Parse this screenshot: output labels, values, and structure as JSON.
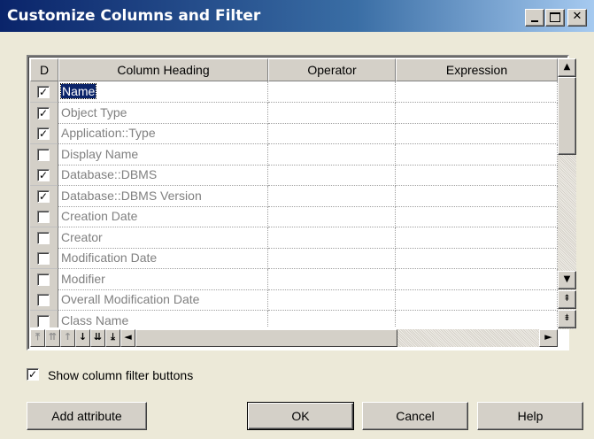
{
  "window": {
    "title": "Customize Columns and Filter",
    "min_label": "_",
    "close_label": "✕"
  },
  "grid": {
    "headers": {
      "d": "D",
      "column_heading": "Column Heading",
      "operator": "Operator",
      "expression": "Expression"
    },
    "rows": [
      {
        "checked": true,
        "name": "Name",
        "selected": true
      },
      {
        "checked": true,
        "name": "Object Type"
      },
      {
        "checked": true,
        "name": "Application::Type"
      },
      {
        "checked": false,
        "name": "Display Name"
      },
      {
        "checked": true,
        "name": "Database::DBMS"
      },
      {
        "checked": true,
        "name": "Database::DBMS Version"
      },
      {
        "checked": false,
        "name": "Creation Date"
      },
      {
        "checked": false,
        "name": "Creator"
      },
      {
        "checked": false,
        "name": "Modification Date"
      },
      {
        "checked": false,
        "name": "Modifier"
      },
      {
        "checked": false,
        "name": "Overall Modification Date"
      },
      {
        "checked": false,
        "name": "Class Name"
      }
    ],
    "scroll": {
      "up": "▲",
      "down": "▼",
      "left": "◄",
      "right": "►",
      "page_up": "⇞",
      "page_down": "⇟"
    },
    "nav_buttons": [
      "⤒",
      "⇈",
      "↑",
      "↓",
      "⇊",
      "⤓"
    ]
  },
  "show_filter": {
    "checked": true,
    "label": "Show column filter buttons"
  },
  "buttons": {
    "add_attribute": "Add attribute",
    "ok": "OK",
    "cancel": "Cancel",
    "help": "Help"
  },
  "colors": {
    "title_start": "#0a246a",
    "title_end": "#a6caf0",
    "dialog_bg": "#ece9d8",
    "disabled_text": "#808080"
  }
}
